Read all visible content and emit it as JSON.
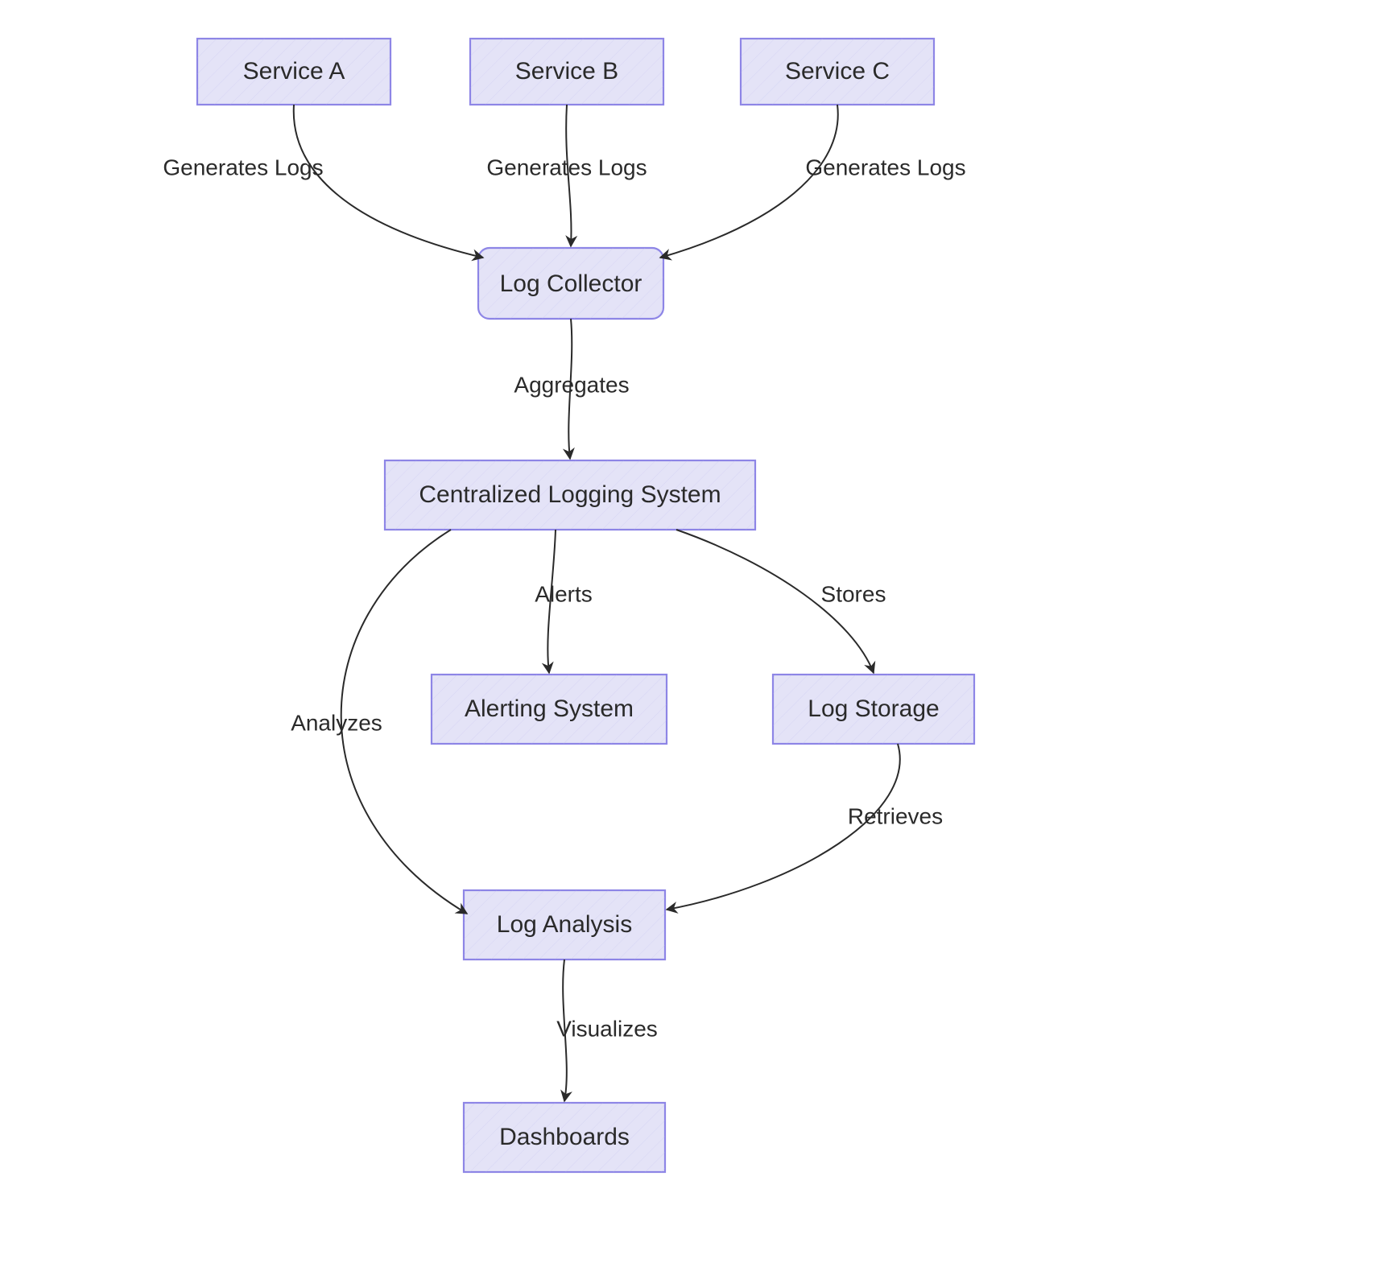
{
  "diagram": {
    "type": "flowchart",
    "style": "hand-drawn",
    "nodes": {
      "service_a": {
        "label": "Service A",
        "shape": "rect"
      },
      "service_b": {
        "label": "Service B",
        "shape": "rect"
      },
      "service_c": {
        "label": "Service C",
        "shape": "rect"
      },
      "collector": {
        "label": "Log Collector",
        "shape": "rounded-rect"
      },
      "central": {
        "label": "Centralized Logging System",
        "shape": "rect"
      },
      "alerting": {
        "label": "Alerting System",
        "shape": "rect"
      },
      "storage": {
        "label": "Log Storage",
        "shape": "rect"
      },
      "analysis": {
        "label": "Log Analysis",
        "shape": "rect"
      },
      "dashboards": {
        "label": "Dashboards",
        "shape": "rect"
      }
    },
    "edges": {
      "a_to_collector": {
        "from": "service_a",
        "to": "collector",
        "label": "Generates Logs"
      },
      "b_to_collector": {
        "from": "service_b",
        "to": "collector",
        "label": "Generates Logs"
      },
      "c_to_collector": {
        "from": "service_c",
        "to": "collector",
        "label": "Generates Logs"
      },
      "collector_to_central": {
        "from": "collector",
        "to": "central",
        "label": "Aggregates"
      },
      "central_to_alerting": {
        "from": "central",
        "to": "alerting",
        "label": "Alerts"
      },
      "central_to_storage": {
        "from": "central",
        "to": "storage",
        "label": "Stores"
      },
      "central_to_analysis": {
        "from": "central",
        "to": "analysis",
        "label": "Analyzes"
      },
      "storage_to_analysis": {
        "from": "storage",
        "to": "analysis",
        "label": "Retrieves"
      },
      "analysis_to_dashboards": {
        "from": "analysis",
        "to": "dashboards",
        "label": "Visualizes"
      }
    },
    "colors": {
      "node_fill": "#e4e3f7",
      "node_stroke": "#8d85e6",
      "edge_stroke": "#2a2a2a",
      "text": "#2a2a2a"
    }
  }
}
